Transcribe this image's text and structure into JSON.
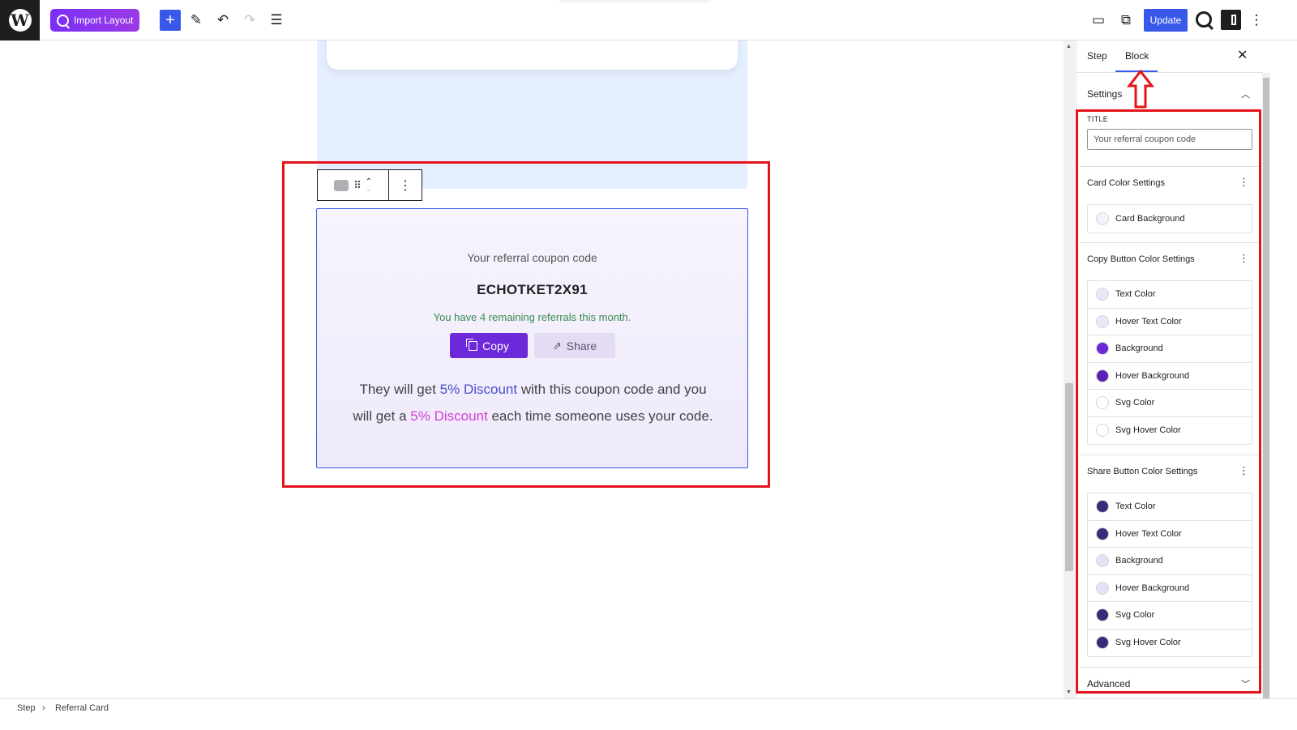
{
  "toolbar": {
    "import_label": "Import Layout",
    "add_symbol": "+",
    "update_label": "Update"
  },
  "canvas": {
    "card": {
      "title": "Your referral coupon code",
      "code": "ECHOTKET2X91",
      "remaining": "You have 4 remaining referrals this month.",
      "copy_label": "Copy",
      "share_label": "Share",
      "desc_1": "They will get ",
      "desc_hl_1": "5% Discount",
      "desc_2": " with this coupon code and you will get a ",
      "desc_hl_2": "5% Discount",
      "desc_3": " each time someone uses your code.",
      "colors": {
        "copy_bg": "#6d28d9",
        "share_bg": "#e4dcf3",
        "hl_1": "#4a50c8",
        "hl_2": "#d13ed1",
        "remaining": "#3a8a4f"
      }
    }
  },
  "sidebar": {
    "tabs": [
      "Step",
      "Block"
    ],
    "active_tab": "Block",
    "settings_heading": "Settings",
    "title_label": "TITLE",
    "title_value": "Your referral coupon code",
    "card_color_heading": "Card Color Settings",
    "card_colors": [
      {
        "label": "Card Background",
        "color": "#f5f2fc"
      }
    ],
    "copy_heading": "Copy Button Color Settings",
    "copy_colors": [
      {
        "label": "Text Color",
        "color": "#ece6f8"
      },
      {
        "label": "Hover Text Color",
        "color": "#ece6f8"
      },
      {
        "label": "Background",
        "color": "#6d28d9"
      },
      {
        "label": "Hover Background",
        "color": "#5b21b6"
      },
      {
        "label": "Svg Color",
        "color": "#ffffff"
      },
      {
        "label": "Svg Hover Color",
        "color": "#ffffff"
      }
    ],
    "share_heading": "Share Button Color Settings",
    "share_colors": [
      {
        "label": "Text Color",
        "color": "#3b2a78"
      },
      {
        "label": "Hover Text Color",
        "color": "#3b2a78"
      },
      {
        "label": "Background",
        "color": "#e7e0f5"
      },
      {
        "label": "Hover Background",
        "color": "#e7e0f5"
      },
      {
        "label": "Svg Color",
        "color": "#3b2a78"
      },
      {
        "label": "Svg Hover Color",
        "color": "#3b2a78"
      }
    ],
    "advanced_heading": "Advanced"
  },
  "footer": {
    "breadcrumb": [
      "Step",
      "Referral Card"
    ],
    "separator": "›"
  },
  "accent_color": "#3858e9",
  "annotation_color": "#e3141b"
}
